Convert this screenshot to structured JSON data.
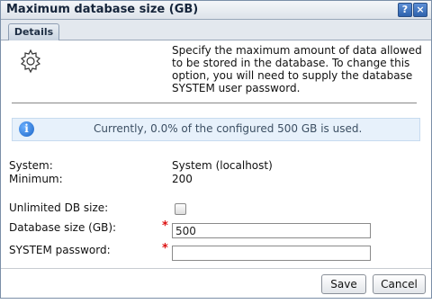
{
  "dialog": {
    "title": "Maximum database size (GB)",
    "help_label": "?",
    "close_label": "×"
  },
  "tabs": [
    {
      "label": "Details",
      "selected": true
    }
  ],
  "description": "Specify the maximum amount of data allowed to be stored in the database. To change this option, you will need to supply the database SYSTEM user password.",
  "info": {
    "icon": "info-icon",
    "glyph": "i",
    "text": "Currently, 0.0% of the configured 500 GB is used."
  },
  "fields": {
    "system": {
      "label": "System:",
      "value": "System (localhost)"
    },
    "minimum": {
      "label": "Minimum:",
      "value": "200"
    },
    "unlimited": {
      "label": "Unlimited DB size:",
      "checked": false
    },
    "db_size": {
      "label": "Database size (GB):",
      "required_mark": "*",
      "value": "500"
    },
    "password": {
      "label": "SYSTEM password:",
      "required_mark": "*",
      "value": ""
    }
  },
  "buttons": {
    "save": "Save",
    "cancel": "Cancel"
  },
  "colors": {
    "titlebar": "#dde3ea",
    "info_bg": "#e7f1fb",
    "required": "#d11111",
    "accent": "#2e62ad"
  }
}
